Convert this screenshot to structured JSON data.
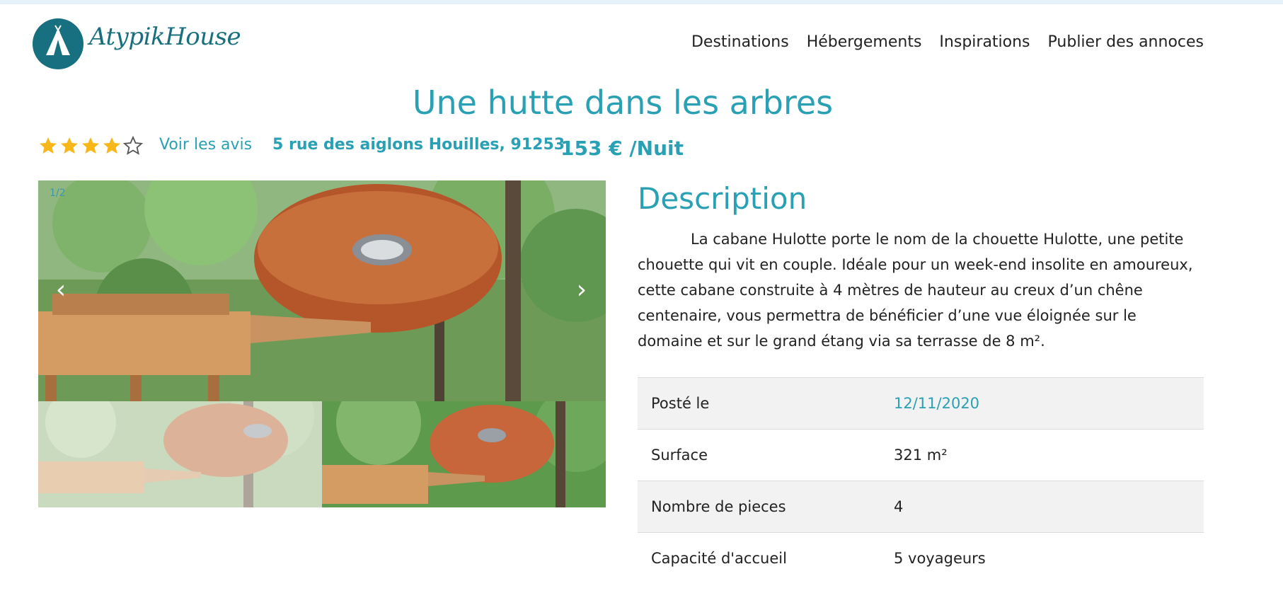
{
  "brand": {
    "name": "AtypikHouse"
  },
  "nav": {
    "items": [
      "Destinations",
      "Hébergements",
      "Inspirations",
      "Publier des annoces"
    ]
  },
  "listing": {
    "title": "Une hutte dans les arbres",
    "rating": {
      "value": 4,
      "max": 5
    },
    "reviews_link": "Voir les avis",
    "address": "5 rue des aiglons Houilles, 91253",
    "price": "153 € /Nuit"
  },
  "gallery": {
    "counter": "1/2",
    "prev_symbol": "‹",
    "next_symbol": "›"
  },
  "description": {
    "heading": "Description",
    "text": "La cabane Hulotte porte le nom de la chouette Hulotte, une petite chouette qui vit en couple. Idéale pour un week-end insolite en amoureux, cette cabane construite à 4 mètres de hauteur au creux d’un chêne centenaire, vous permettra de bénéficier d’une vue éloignée sur le domaine et sur le grand étang via sa terrasse de 8 m²."
  },
  "details": {
    "rows": [
      {
        "label": "Posté le",
        "value": "12/11/2020"
      },
      {
        "label": "Surface",
        "value": "321 m²"
      },
      {
        "label": "Nombre de pieces",
        "value": "4"
      },
      {
        "label": "Capacité d'accueil",
        "value": "5 voyageurs"
      }
    ]
  },
  "colors": {
    "accent": "#2aa0b5",
    "logo_bg": "#17707f",
    "star": "#f7b718",
    "row_stripe": "#f2f2f2"
  },
  "icons": {
    "logo": "teepee-icon",
    "star_full": "star-filled-icon",
    "star_empty": "star-outline-icon"
  }
}
